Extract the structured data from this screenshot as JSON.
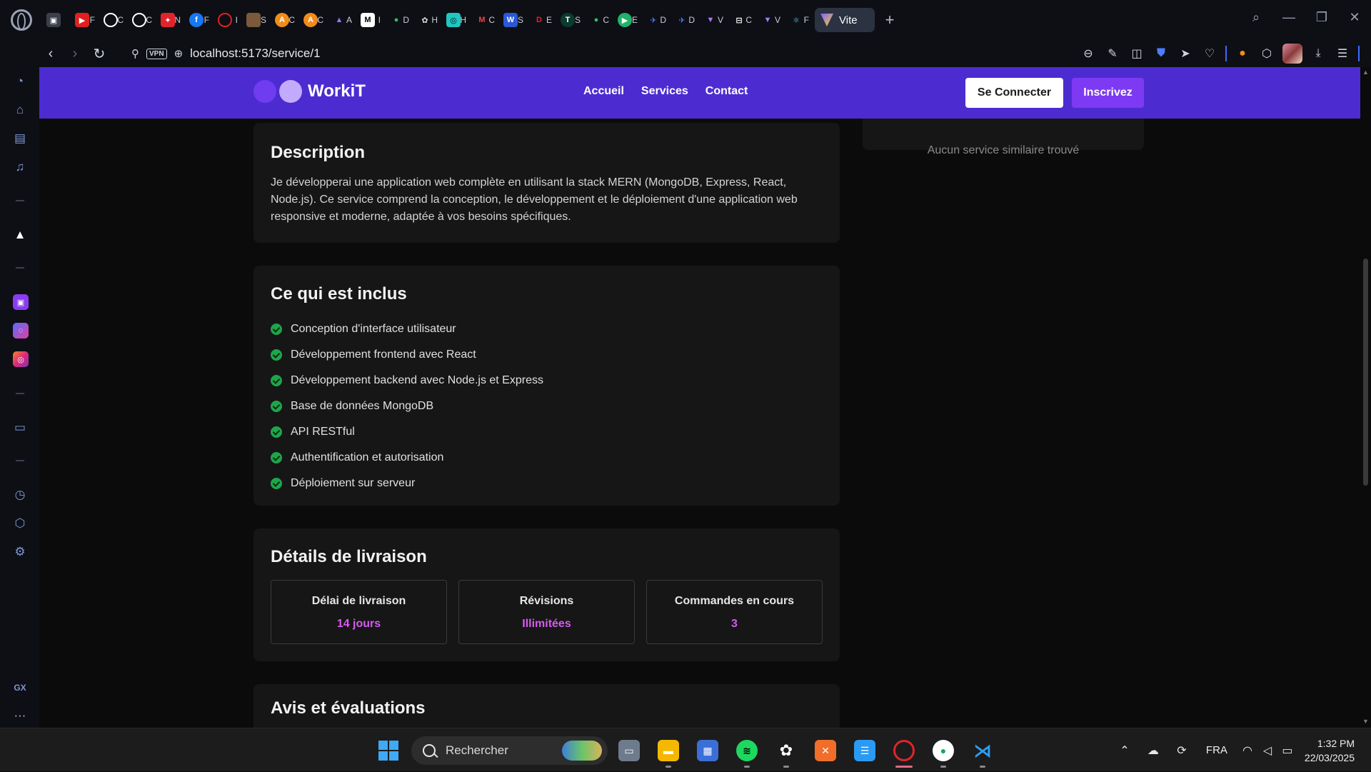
{
  "browser": {
    "active_tab_label": "Vite",
    "new_tab": "+",
    "url": "localhost:5173/service/1",
    "vpn_badge": "VPN",
    "sidebar_footer": "GX",
    "sidebar_more": "⋯",
    "tab_initials": [
      "F",
      "C",
      "C",
      "N",
      "F",
      "I",
      "S",
      "C",
      "C",
      "A",
      "I",
      "D",
      "H",
      "H",
      "C",
      "S",
      "E",
      "S",
      "C",
      "E",
      "D",
      "D",
      "V",
      "C",
      "V",
      "F"
    ]
  },
  "site": {
    "brand": "WorkiT",
    "nav": {
      "home": "Accueil",
      "services": "Services",
      "contact": "Contact"
    },
    "login_label": "Se Connecter",
    "signup_label": "Inscrivez"
  },
  "similar": {
    "empty_text": "Aucun service similaire trouvé"
  },
  "description": {
    "title": "Description",
    "text": "Je développerai une application web complète en utilisant la stack MERN (MongoDB, Express, React, Node.js). Ce service comprend la conception, le développement et le déploiement d'une application web responsive et moderne, adaptée à vos besoins spécifiques."
  },
  "included": {
    "title": "Ce qui est inclus",
    "items": [
      "Conception d'interface utilisateur",
      "Développement frontend avec React",
      "Développement backend avec Node.js et Express",
      "Base de données MongoDB",
      "API RESTful",
      "Authentification et autorisation",
      "Déploiement sur serveur"
    ]
  },
  "delivery": {
    "title": "Détails de livraison",
    "stats": [
      {
        "label": "Délai de livraison",
        "value": "14 jours"
      },
      {
        "label": "Révisions",
        "value": "Illimitées"
      },
      {
        "label": "Commandes en cours",
        "value": "3"
      }
    ]
  },
  "reviews": {
    "title": "Avis et évaluations"
  },
  "taskbar": {
    "search_placeholder": "Rechercher",
    "language": "FRA",
    "time": "1:32 PM",
    "date": "22/03/2025"
  },
  "colors": {
    "header_bg": "#4c2cd1",
    "accent_purple": "#7e3af2",
    "value_pink": "#d55bf0",
    "check_green": "#1ea54a",
    "card_bg": "#161616"
  }
}
